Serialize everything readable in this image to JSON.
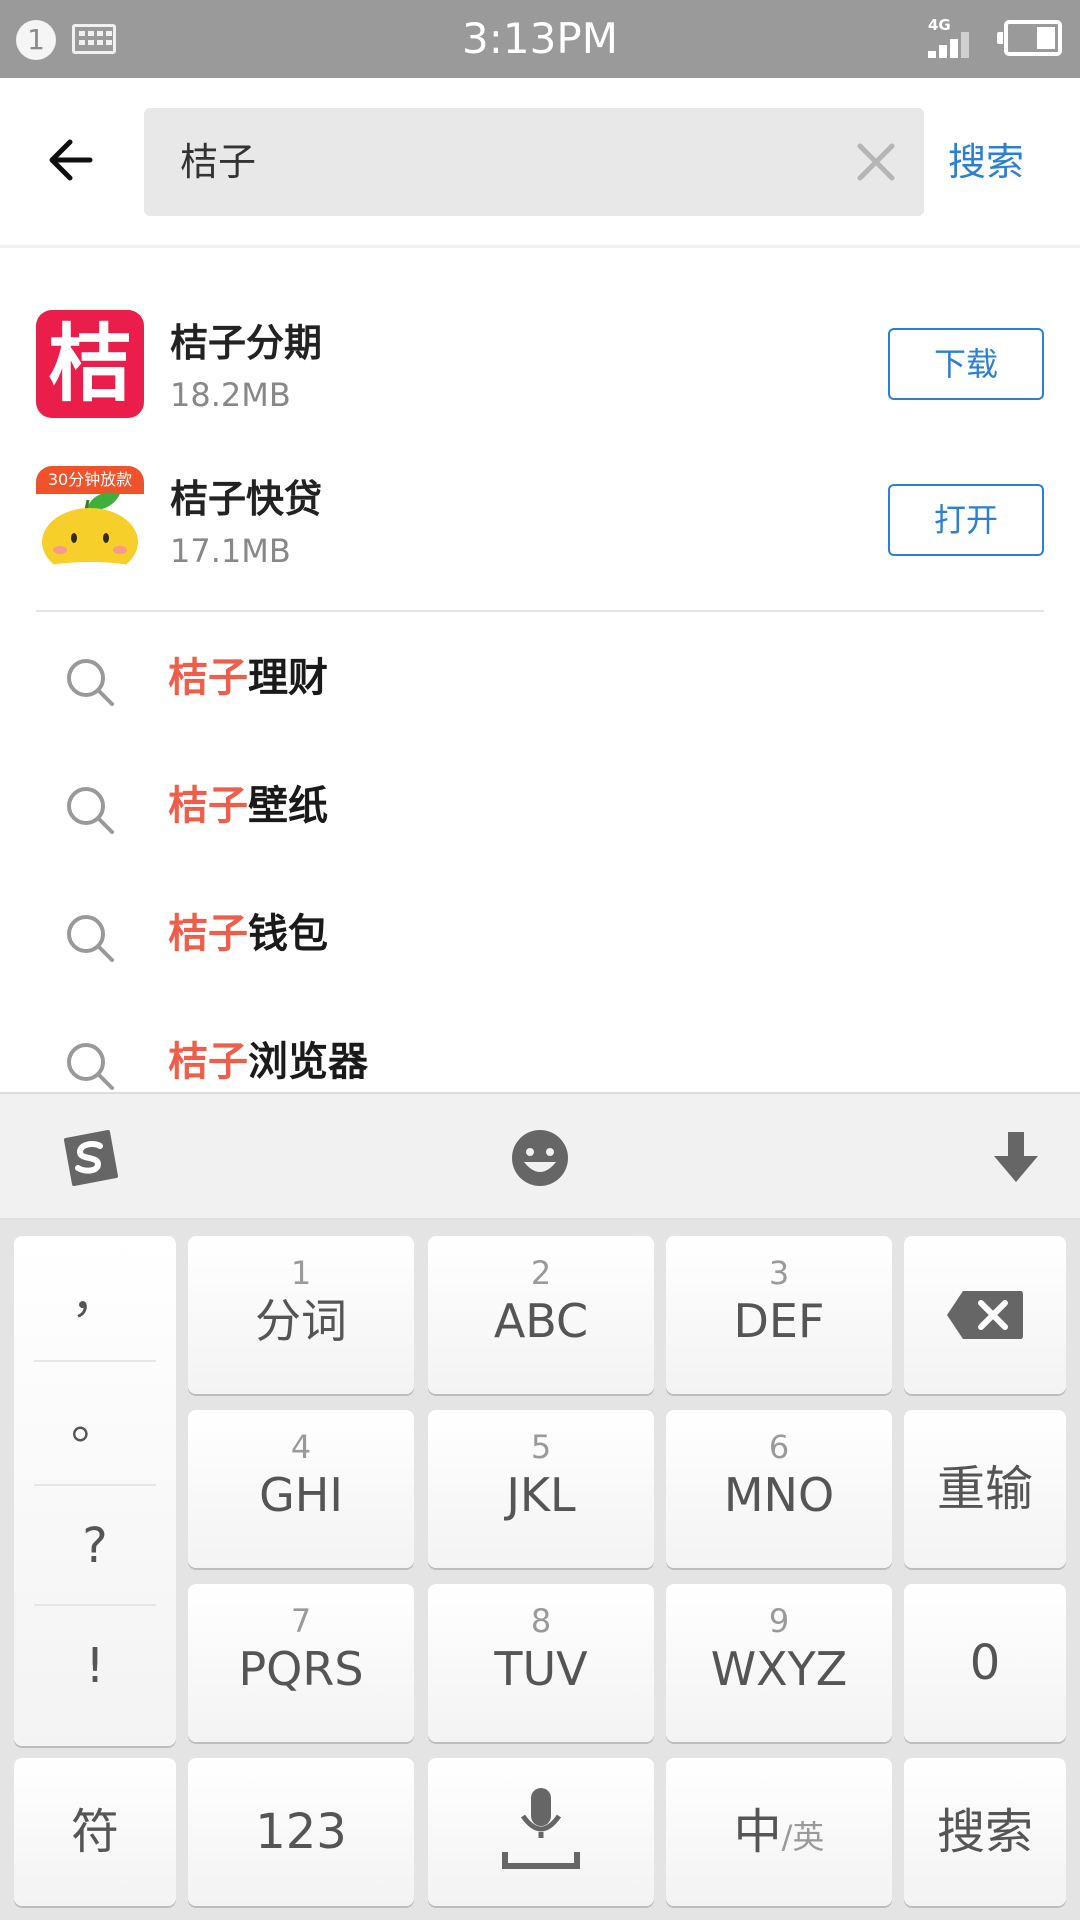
{
  "status_bar": {
    "notification_count": "1",
    "time": "3:13PM",
    "network": "4G"
  },
  "header": {
    "search_value": "桔子",
    "search_button": "搜索"
  },
  "apps": [
    {
      "name": "桔子分期",
      "size": "18.2MB",
      "button": "下载",
      "icon_glyph": "桔"
    },
    {
      "name": "桔子快贷",
      "size": "17.1MB",
      "button": "打开",
      "icon_tag": "30分钟放款"
    }
  ],
  "suggestions": [
    {
      "highlight": "桔子",
      "rest": "理财"
    },
    {
      "highlight": "桔子",
      "rest": "壁纸"
    },
    {
      "highlight": "桔子",
      "rest": "钱包"
    },
    {
      "highlight": "桔子",
      "rest": "浏览器"
    }
  ],
  "keyboard": {
    "toolbar": [
      "sogou-logo-icon",
      "emoji-icon",
      "hide-keyboard-icon"
    ],
    "punctuation": [
      "，",
      "。",
      "?",
      "!"
    ],
    "keys": [
      {
        "num": "1",
        "label": "分词"
      },
      {
        "num": "2",
        "label": "ABC"
      },
      {
        "num": "3",
        "label": "DEF"
      },
      {
        "num": "4",
        "label": "GHI"
      },
      {
        "num": "5",
        "label": "JKL"
      },
      {
        "num": "6",
        "label": "MNO"
      },
      {
        "num": "7",
        "label": "PQRS"
      },
      {
        "num": "8",
        "label": "TUV"
      },
      {
        "num": "9",
        "label": "WXYZ"
      }
    ],
    "reset_key": "重输",
    "zero_key": "0",
    "symbol_key": "符",
    "numeric_key": "123",
    "lang_key_main": "中",
    "lang_key_sub": "/英",
    "search_key": "搜索"
  },
  "colors": {
    "accent_blue": "#2b7fd4",
    "highlight_red": "#ee5e4b",
    "status_bar": "#9a9a9a"
  }
}
